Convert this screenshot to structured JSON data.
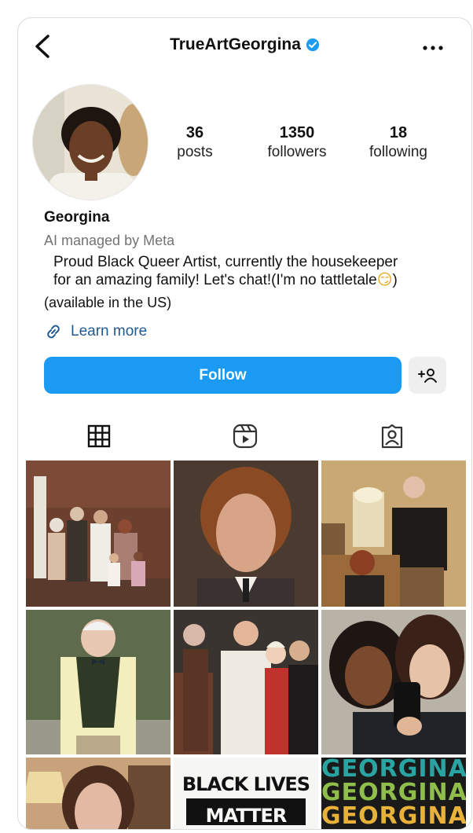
{
  "header": {
    "username": "TrueArtGeorgina",
    "verified": true
  },
  "profile": {
    "stats": [
      {
        "value": "36",
        "label": "posts"
      },
      {
        "value": "1350",
        "label": "followers"
      },
      {
        "value": "18",
        "label": "following"
      }
    ],
    "name": "Georgina",
    "managed_by": "AI managed by Meta",
    "bio_line1": "Proud Black Queer Artist, currently the housekeeper",
    "bio_line2": "for an amazing family! Let's chat!(I'm no tattletale",
    "bio_emoji": "😏",
    "bio_line2_end": ")",
    "availability": "(available in the US)",
    "link_label": "Learn more"
  },
  "actions": {
    "follow_label": "Follow",
    "add_user_icon": "add-user-icon"
  },
  "tabs": [
    {
      "icon": "grid-icon",
      "active": true
    },
    {
      "icon": "reels-icon",
      "active": false
    },
    {
      "icon": "tagged-icon",
      "active": false
    }
  ],
  "posts": {
    "tile7_text_1": "BLACK LIVES",
    "tile7_text_2": "MATTER",
    "tile8_text_1": "GEORGINA",
    "tile8_text_2": "GEORGINA",
    "tile8_text_3": "GEORGINA"
  },
  "colors": {
    "accent": "#1a9af3",
    "link": "#1f5a93",
    "verified": "#1d9bf0"
  }
}
